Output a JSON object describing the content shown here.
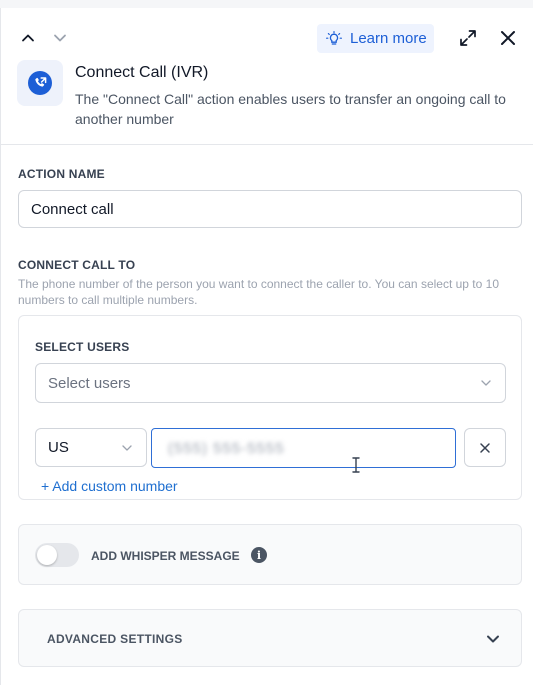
{
  "topbar": {
    "up_icon": "chevron-up-icon",
    "down_icon": "chevron-down-icon",
    "learn_more_label": "Learn more",
    "expand_icon": "expand-icon",
    "close_icon": "close-icon"
  },
  "header": {
    "icon": "phone-transfer-icon",
    "title": "Connect Call (IVR)",
    "description": "The \"Connect Call\" action enables users to transfer an ongoing call to another number"
  },
  "action_name": {
    "label": "ACTION NAME",
    "value": "Connect call"
  },
  "connect_call_to": {
    "label": "CONNECT CALL TO",
    "help": "The phone number of the person you want to connect the caller to. You can select up to 10 numbers to call multiple numbers."
  },
  "select_users": {
    "label": "SELECT USERS",
    "placeholder": "Select users"
  },
  "phone": {
    "country": "US",
    "number": "(555) 555-5555",
    "clear_icon": "close-icon"
  },
  "add_custom_number": "+ Add custom number",
  "whisper": {
    "label": "ADD WHISPER MESSAGE",
    "enabled": false,
    "info_icon": "info-icon"
  },
  "advanced": {
    "label": "ADVANCED SETTINGS"
  },
  "colors": {
    "accent": "#1f6fd0",
    "learn_bg": "#eef3fe",
    "focus_border": "#2f6fd6"
  }
}
